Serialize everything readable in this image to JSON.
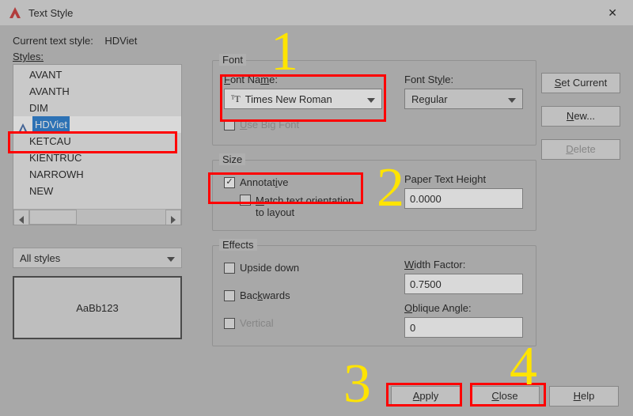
{
  "window": {
    "title": "Text Style"
  },
  "current_style_label": "Current text style:",
  "current_style_value": "HDViet",
  "styles_label": "Styles:",
  "styles_list": [
    "AVANT",
    "AVANTH",
    "DIM",
    "HDViet",
    "KETCAU",
    "KIENTRUC",
    "NARROWH",
    "NEW"
  ],
  "styles_selected_index": 3,
  "filter": {
    "value": "All styles"
  },
  "preview_text": "AaBb123",
  "font": {
    "group": "Font",
    "name_label": "Font Name:",
    "name_value": "Times New Roman",
    "style_label": "Font Style:",
    "style_value": "Regular",
    "use_big_font": "Use Big Font",
    "use_big_font_checked": false
  },
  "size": {
    "group": "Size",
    "annotative": "Annotative",
    "annotative_checked": true,
    "match_label": "Match text orientation to layout",
    "match_checked": false,
    "paper_height_label": "Paper Text Height",
    "paper_height_value": "0.0000"
  },
  "effects": {
    "group": "Effects",
    "upside": "Upside down",
    "upside_checked": false,
    "backwards": "Backwards",
    "backwards_checked": false,
    "vertical": "Vertical",
    "vertical_checked": false,
    "width_label": "Width Factor:",
    "width_value": "0.7500",
    "oblique_label": "Oblique Angle:",
    "oblique_value": "0"
  },
  "buttons": {
    "set_current": "Set Current",
    "new": "New...",
    "delete": "Delete",
    "apply": "Apply",
    "close": "Close",
    "help": "Help"
  },
  "annotations": {
    "n1": "1",
    "n2": "2",
    "n3": "3",
    "n4": "4"
  }
}
